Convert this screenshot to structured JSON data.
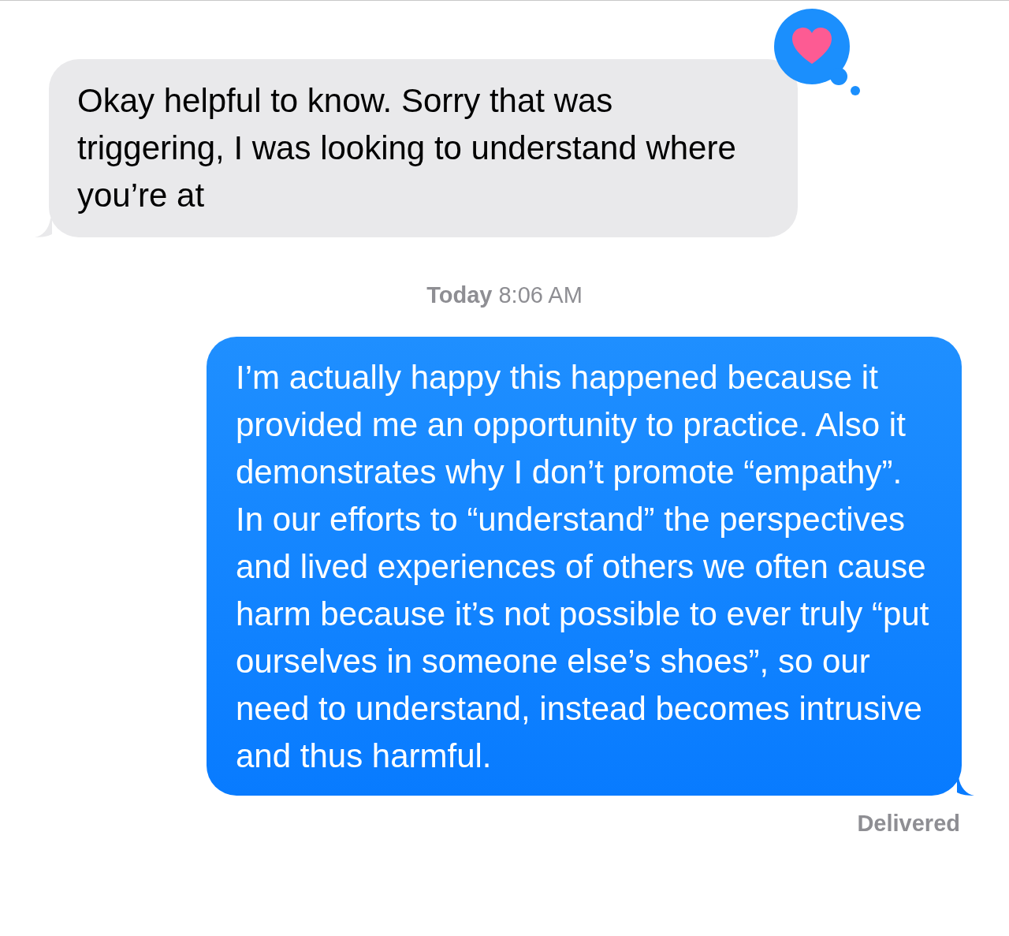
{
  "messages": [
    {
      "kind": "received",
      "text": "Okay helpful to know. Sorry that was triggering, I was looking to understand where you’re at",
      "reacted": true
    },
    {
      "kind": "timestamp",
      "day": "Today",
      "time": "8:06 AM"
    },
    {
      "kind": "sent",
      "text": "I’m actually happy this happened because it provided me an opportunity to practice. Also it demonstrates why I don’t promote “empathy”. In our efforts to “understand” the perspectives and lived experiences of others we often cause harm because it’s not possible to ever truly “put ourselves in someone else’s shoes”, so our need to understand, instead becomes intrusive and thus harmful.",
      "status": "Delivered"
    }
  ]
}
